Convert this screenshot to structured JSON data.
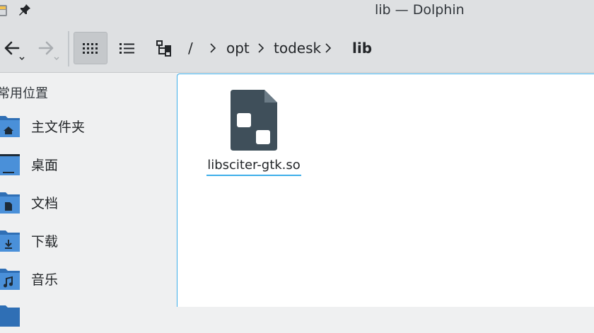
{
  "window": {
    "title": "lib — Dolphin"
  },
  "breadcrumb": {
    "root": "/",
    "items": [
      "opt",
      "todesk",
      "lib"
    ]
  },
  "sidebar": {
    "heading": "常用位置",
    "items": [
      {
        "label": "主文件夹",
        "icon": "home-folder-icon"
      },
      {
        "label": "桌面",
        "icon": "desktop-icon"
      },
      {
        "label": "文档",
        "icon": "documents-folder-icon"
      },
      {
        "label": "下载",
        "icon": "downloads-folder-icon"
      },
      {
        "label": "音乐",
        "icon": "music-folder-icon"
      }
    ]
  },
  "files": [
    {
      "name": "libsciter-gtk.so",
      "icon": "shared-library-icon"
    }
  ],
  "colors": {
    "accent": "#3daee9",
    "folder": "#4a90d9",
    "file_icon": "#3f4f5a"
  }
}
